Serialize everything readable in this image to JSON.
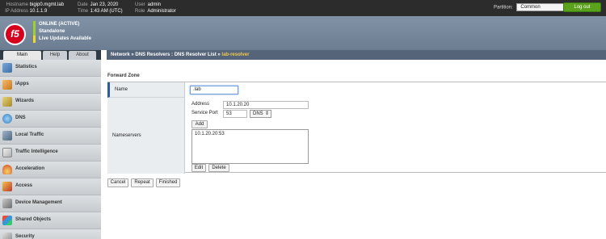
{
  "topbar": {
    "hostname_label": "Hostname",
    "hostname": "bigip0.mgmt.lab",
    "ip_label": "IP Address",
    "ip": "10.1.1.9",
    "date_label": "Date",
    "date": "Jan 23, 2020",
    "time_label": "Time",
    "time": "1:43 AM (UTC)",
    "user_label": "User",
    "user": "admin",
    "role_label": "Role",
    "role": "Administrator",
    "partition_label": "Partition:",
    "partition_value": "Common",
    "logout_label": "Log out"
  },
  "header": {
    "logo_text": "f5",
    "status": [
      "ONLINE (ACTIVE)",
      "Standalone",
      "Live Updates Available"
    ]
  },
  "tabs": [
    "Main",
    "Help",
    "About"
  ],
  "sidebar": {
    "items": [
      {
        "label": "Statistics",
        "icon": "statistics-icon"
      },
      {
        "label": "iApps",
        "icon": "iapps-icon"
      },
      {
        "label": "Wizards",
        "icon": "wizards-icon"
      },
      {
        "label": "DNS",
        "icon": "dns-icon"
      },
      {
        "label": "Local Traffic",
        "icon": "local-traffic-icon"
      },
      {
        "label": "Traffic Intelligence",
        "icon": "traffic-intelligence-icon"
      },
      {
        "label": "Acceleration",
        "icon": "acceleration-icon"
      },
      {
        "label": "Access",
        "icon": "access-icon"
      },
      {
        "label": "Device Management",
        "icon": "device-management-icon"
      },
      {
        "label": "Shared Objects",
        "icon": "shared-objects-icon"
      },
      {
        "label": "Security",
        "icon": "security-icon"
      }
    ]
  },
  "breadcrumb": {
    "part1": "Network",
    "sep": "»",
    "part2": "DNS Resolvers : DNS Resolver List",
    "current": "lab-resolver"
  },
  "form": {
    "section_title": "Forward Zone",
    "name_label": "Name",
    "name_value": ".lab",
    "nameservers_label": "Nameservers",
    "address_label": "Address",
    "address_value": "10.1.20.20",
    "service_port_label": "Service Port",
    "service_port_value": "53",
    "service_select": "DNS",
    "add_label": "Add",
    "list_items": [
      "10.1.20.20:53"
    ],
    "edit_label": "Edit",
    "delete_label": "Delete"
  },
  "actions": {
    "cancel": "Cancel",
    "repeat": "Repeat",
    "finished": "Finished"
  },
  "colors": {
    "logout_bg": "#5aa21b",
    "breadcrumb_current": "#f2c94c",
    "logo": "#d6001c"
  }
}
